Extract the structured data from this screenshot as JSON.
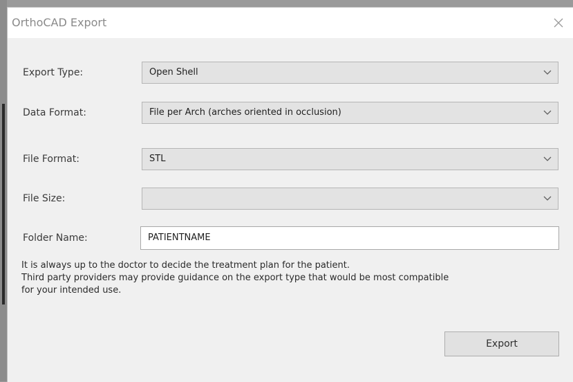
{
  "window": {
    "title": "OrthoCAD Export"
  },
  "form": {
    "export_type": {
      "label": "Export Type:",
      "value": "Open Shell"
    },
    "data_format": {
      "label": "Data Format:",
      "value": "File per Arch (arches oriented in occlusion)"
    },
    "file_format": {
      "label": "File Format:",
      "value": "STL"
    },
    "file_size": {
      "label": "File Size:",
      "value": ""
    },
    "folder_name": {
      "label": "Folder Name:",
      "value": "PATIENTNAME"
    }
  },
  "notice": {
    "lines": [
      "It is always up to the doctor to decide the treatment plan for the patient.",
      "Third party providers may provide guidance on the export type that would be most compatible",
      "for your intended use."
    ]
  },
  "buttons": {
    "export_label": "Export"
  },
  "icons": {
    "close": "close-icon",
    "dropdown": "chevron-down-icon"
  }
}
